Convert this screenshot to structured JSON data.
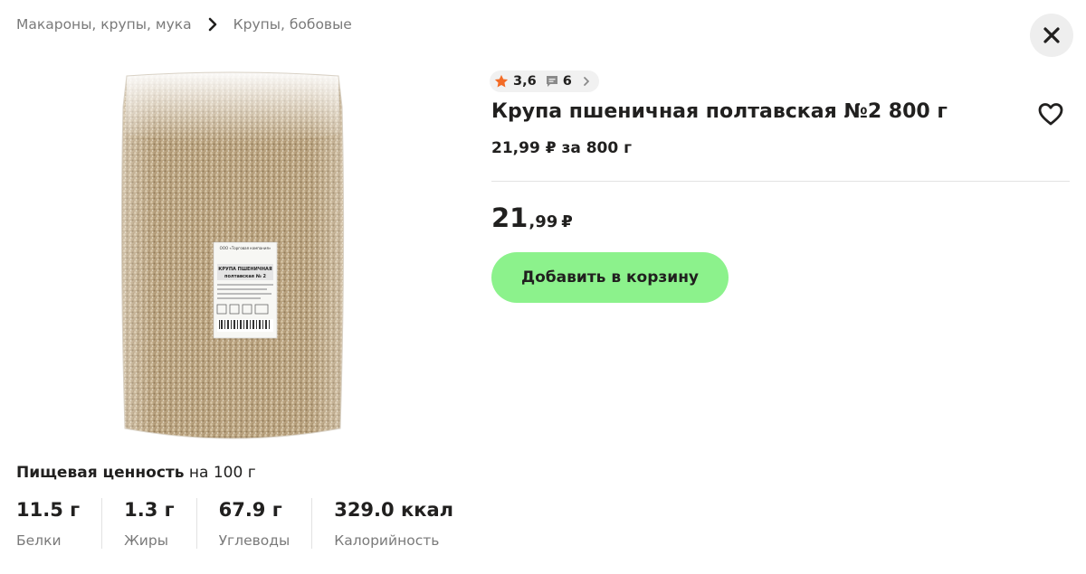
{
  "breadcrumb": {
    "items": [
      "Макароны, крупы, мука",
      "Крупы, бобовые"
    ]
  },
  "product": {
    "title": "Крупа пшеничная полтавская №2 800 г",
    "unit_price": "21,99 ₽ за 800 г",
    "rating": "3,6",
    "reviews_count": "6",
    "price_int": "21",
    "price_frac": ",99",
    "currency": "₽",
    "label_company": "ООО «Торговая компания»",
    "label_name_line1": "КРУПА ПШЕНИЧНАЯ",
    "label_name_line2": "полтавская № 2"
  },
  "actions": {
    "add_to_cart": "Добавить в корзину"
  },
  "nutrition": {
    "heading_bold": "Пищевая ценность",
    "heading_rest": " на 100 г",
    "items": [
      {
        "value": "11.5 г",
        "label": "Белки"
      },
      {
        "value": "1.3 г",
        "label": "Жиры"
      },
      {
        "value": "67.9 г",
        "label": "Углеводы"
      },
      {
        "value": "329.0 ккал",
        "label": "Калорийность"
      }
    ]
  },
  "colors": {
    "accent_button": "#8cf28c",
    "star": "#f36b26",
    "text": "#21201f",
    "muted": "#7a7a7a"
  },
  "icons": [
    "chevron-right-icon",
    "close-icon",
    "star-icon",
    "comment-icon",
    "heart-icon"
  ]
}
